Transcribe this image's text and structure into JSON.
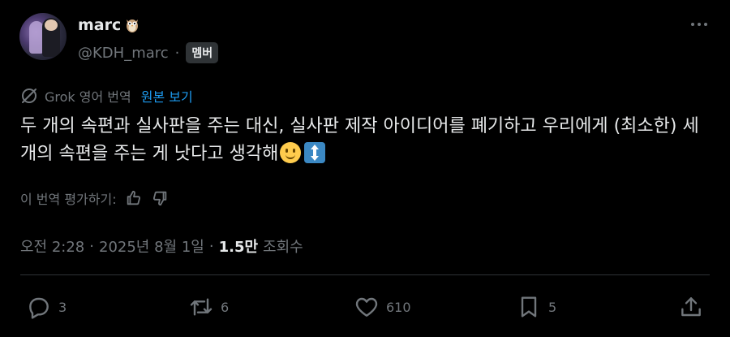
{
  "author": {
    "name": "marc",
    "name_emoji_icon": "owl-icon",
    "handle": "@KDH_marc",
    "separator": "·",
    "badge": "멤버"
  },
  "translation": {
    "label": "Grok 영어 번역",
    "show_original": "원본 보기",
    "icon": "grok-icon"
  },
  "tweet": {
    "text": "두 개의 속편과 실사판을 주는 대신, 실사판 제작 아이디어를 폐기하고 우리에게 (최소한) 세 개의 속편을 주는 게 낫다고 생각해",
    "emojis": [
      "slightly-smiling-face",
      "up-down-arrow"
    ]
  },
  "rate": {
    "label": "이 번역 평가하기:",
    "icons": [
      "thumbs-up-icon",
      "thumbs-down-icon"
    ]
  },
  "meta": {
    "time": "오전 2:28",
    "sep1": "·",
    "date": "2025년 8월 1일",
    "sep2": "·",
    "views_count": "1.5만",
    "views_label": "조회수"
  },
  "actions": {
    "replies": "3",
    "reposts": "6",
    "likes": "610",
    "bookmarks": "5"
  },
  "colors": {
    "background": "#000000",
    "text": "#e7e9ea",
    "muted": "#71767b",
    "link": "#1d9bf0"
  }
}
